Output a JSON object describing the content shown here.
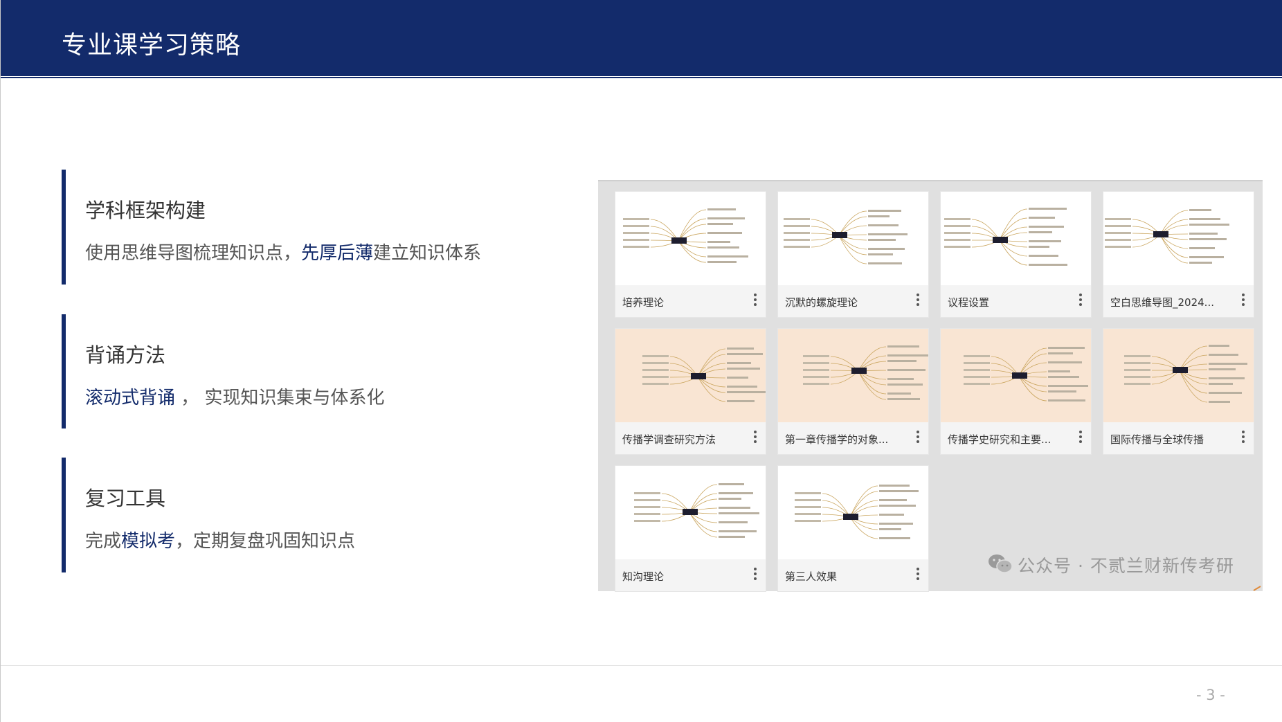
{
  "header": {
    "title": "专业课学习策略"
  },
  "sections": [
    {
      "heading": "学科框架构建",
      "desc_pre": "使用思维导图梳理知识点，",
      "desc_hl": "先厚后薄",
      "desc_post": "建立知识体系"
    },
    {
      "heading": "背诵方法",
      "desc_hl": "滚动式背诵",
      "desc_post": " ， 实现知识集束与体系化"
    },
    {
      "heading": "复习工具",
      "desc_pre": "完成",
      "desc_hl": "模拟考",
      "desc_post": "，定期复盘巩固知识点"
    }
  ],
  "cards": [
    {
      "label": "培养理论",
      "style": "white"
    },
    {
      "label": "沉默的螺旋理论",
      "style": "white"
    },
    {
      "label": "议程设置",
      "style": "white"
    },
    {
      "label": "空白思维导图_2024...",
      "style": "white"
    },
    {
      "label": "传播学调查研究方法",
      "style": "peach"
    },
    {
      "label": "第一章传播学的对象...",
      "style": "peach"
    },
    {
      "label": "传播学史研究和主要...",
      "style": "peach"
    },
    {
      "label": "国际传播与全球传播",
      "style": "peach"
    },
    {
      "label": "知沟理论",
      "style": "white"
    },
    {
      "label": "第三人效果",
      "style": "white"
    }
  ],
  "watermark": "公众号 · 不贰兰财新传考研",
  "page_number": "- 3 -",
  "colors": {
    "brand": "#132b6b",
    "peach": "#f9e5d3"
  }
}
